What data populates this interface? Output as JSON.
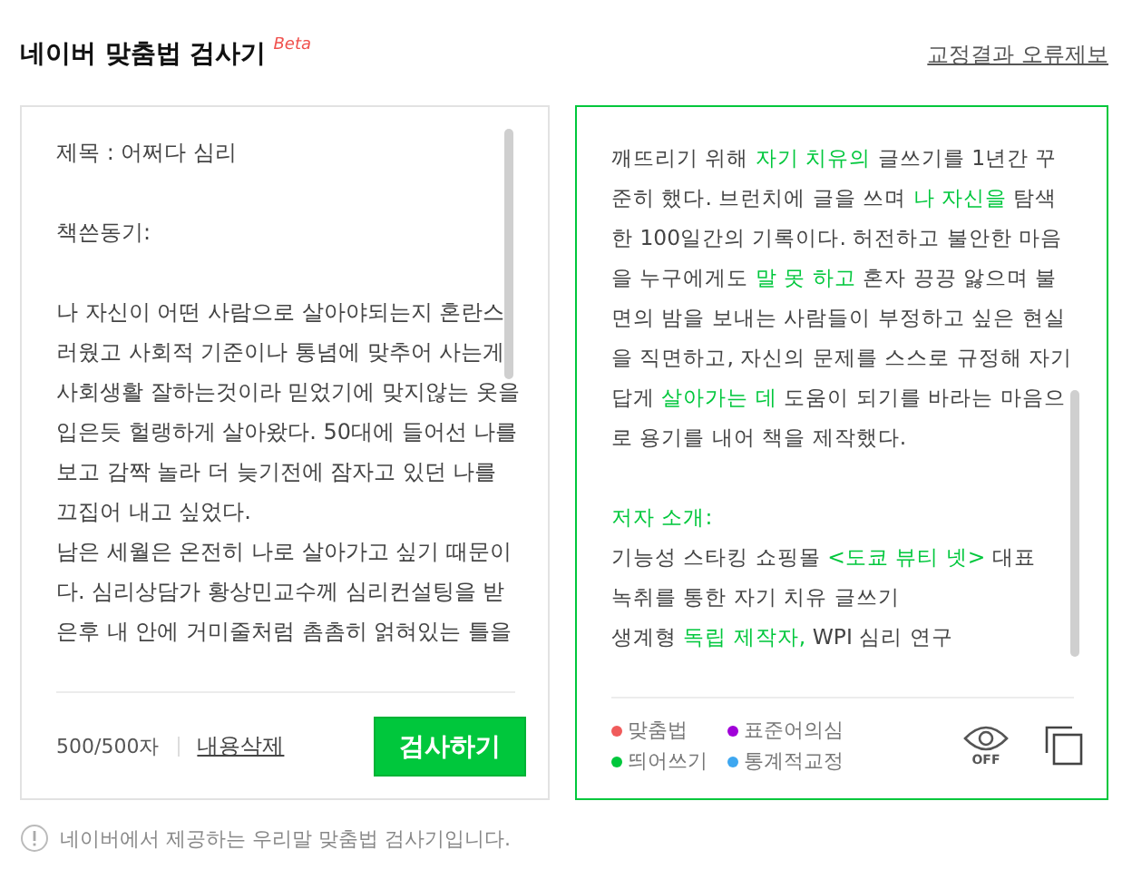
{
  "header": {
    "title": "네이버 맞춤법 검사기",
    "badge": "Beta",
    "report_link": "교정결과 오류제보"
  },
  "input_panel": {
    "paragraphs": [
      {
        "lines": [
          "제목 : 어쩌다 심리"
        ]
      },
      {
        "lines": [
          "책쓴동기:"
        ]
      },
      {
        "lines": [
          "나 자신이 어떤 사람으로 살아야되는지 혼란스",
          "러웠고 사회적 기준이나 통념에 맞추어 사는게",
          "사회생활 잘하는것이라 믿었기에 맞지않는 옷을",
          "입은듯 헐랭하게 살아왔다.  50대에 들어선 나를",
          "보고 감짝 놀라 더 늦기전에 잠자고 있던 나를",
          "끄집어 내고 싶었다.",
          "남은 세월은 온전히 나로 살아가고 싶기 때문이",
          "다. 심리상담가 황상민교수께 심리컨설팅을 받",
          "은후 내 안에 거미줄처럼 촘촘히 얽혀있는 틀을"
        ]
      }
    ],
    "count": "500/500자",
    "clear_link": "내용삭제",
    "check_button": "검사하기"
  },
  "result_panel": {
    "paragraphs": [
      {
        "lines": [
          [
            {
              "text": "깨뜨리기 위해 ",
              "highlight": false
            },
            {
              "text": "자기 치유의",
              "highlight": true
            },
            {
              "text": " 글쓰기를 1년간 꾸",
              "highlight": false
            }
          ],
          [
            {
              "text": "준히 했다. 브런치에 글을 쓰며 ",
              "highlight": false
            },
            {
              "text": "나 자신을",
              "highlight": true
            },
            {
              "text": " 탐색",
              "highlight": false
            }
          ],
          [
            {
              "text": "한 100일간의 기록이다. 허전하고 불안한 마음",
              "highlight": false
            }
          ],
          [
            {
              "text": "을 누구에게도 ",
              "highlight": false
            },
            {
              "text": "말 못 하고",
              "highlight": true
            },
            {
              "text": " 혼자 끙끙 앓으며 불",
              "highlight": false
            }
          ],
          [
            {
              "text": "면의 밤을 보내는 사람들이 부정하고 싶은 현실",
              "highlight": false
            }
          ],
          [
            {
              "text": "을 직면하고, 자신의 문제를 스스로 규정해 자기",
              "highlight": false
            }
          ],
          [
            {
              "text": "답게 ",
              "highlight": false
            },
            {
              "text": "살아가는 데",
              "highlight": true
            },
            {
              "text": " 도움이 되기를 바라는 마음으",
              "highlight": false
            }
          ],
          [
            {
              "text": "로 용기를 내어 책을 제작했다.",
              "highlight": false
            }
          ]
        ]
      },
      {
        "lines": [
          [
            {
              "text": "저자 소개:",
              "highlight": true
            }
          ],
          [
            {
              "text": "기능성 스타킹 쇼핑몰 ",
              "highlight": false
            },
            {
              "text": "<도쿄 뷰티 넷>",
              "highlight": true
            },
            {
              "text": " 대표",
              "highlight": false
            }
          ],
          [
            {
              "text": "녹취를 통한 자기 치유 글쓰기",
              "highlight": false
            }
          ],
          [
            {
              "text": "생계형 ",
              "highlight": false
            },
            {
              "text": "독립 제작자,",
              "highlight": true
            },
            {
              "text": " WPI 심리 연구",
              "highlight": false
            }
          ]
        ]
      }
    ],
    "legend": [
      {
        "label": "맞춤법",
        "color": "#f05b5b"
      },
      {
        "label": "표준어의심",
        "color": "#a000d8"
      },
      {
        "label": "띄어쓰기",
        "color": "#00c73c"
      },
      {
        "label": "통계적교정",
        "color": "#3ea7f0"
      }
    ],
    "eye_label": "OFF"
  },
  "footer_note": "네이버에서 제공하는 우리말 맞춤법 검사기입니다."
}
